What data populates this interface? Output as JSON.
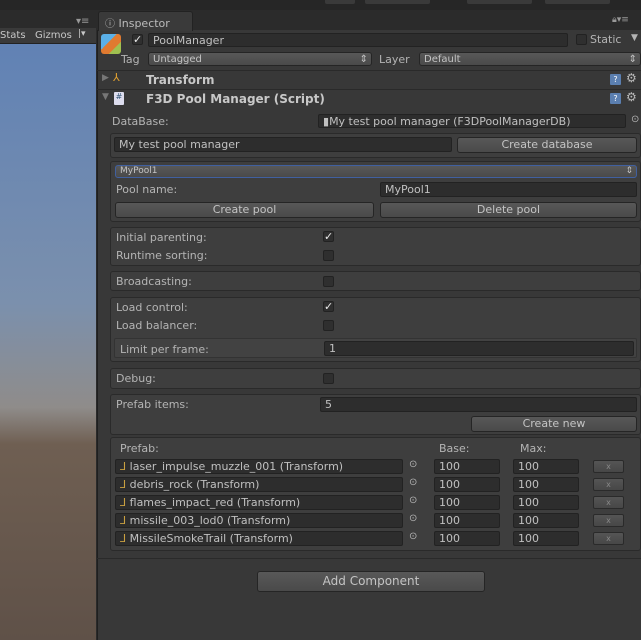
{
  "scene": {
    "stats": "Stats",
    "gizmos": "Gizmos"
  },
  "inspector": {
    "tab_label": "Inspector",
    "object_name": "PoolManager",
    "active": true,
    "static_label": "Static",
    "tag_label": "Tag",
    "tag_value": "Untagged",
    "layer_label": "Layer",
    "layer_value": "Default",
    "components": [
      {
        "name": "Transform",
        "expanded": false
      },
      {
        "name": "F3D Pool Manager (Script)",
        "expanded": true
      }
    ],
    "script": {
      "database_label": "DataBase:",
      "database_value": "My test pool manager (F3DPoolManagerDB)",
      "db_name_value": "My test pool manager",
      "create_database": "Create database",
      "pool_select": "MyPool1",
      "pool_name_label": "Pool name:",
      "pool_name_value": "MyPool1",
      "create_pool": "Create pool",
      "delete_pool": "Delete pool",
      "initial_parenting": {
        "label": "Initial parenting:",
        "checked": true
      },
      "runtime_sorting": {
        "label": "Runtime sorting:",
        "checked": false
      },
      "broadcasting": {
        "label": "Broadcasting:",
        "checked": false
      },
      "load_control": {
        "label": "Load control:",
        "checked": true
      },
      "load_balancer": {
        "label": "Load balancer:",
        "checked": false
      },
      "limit_label": "Limit per frame:",
      "limit_value": "1",
      "debug": {
        "label": "Debug:",
        "checked": false
      },
      "prefab_items_label": "Prefab items:",
      "prefab_items_value": "5",
      "create_new": "Create new",
      "col_prefab": "Prefab:",
      "col_base": "Base:",
      "col_max": "Max:",
      "prefabs": [
        {
          "name": "laser_impulse_muzzle_001 (Transform)",
          "base": "100",
          "max": "100",
          "remove": "x"
        },
        {
          "name": "debris_rock (Transform)",
          "base": "100",
          "max": "100",
          "remove": "x"
        },
        {
          "name": "flames_impact_red (Transform)",
          "base": "100",
          "max": "100",
          "remove": "x"
        },
        {
          "name": "missile_003_lod0 (Transform)",
          "base": "100",
          "max": "100",
          "remove": "x"
        },
        {
          "name": "MissileSmokeTrail (Transform)",
          "base": "100",
          "max": "100",
          "remove": "x"
        }
      ]
    },
    "add_component": "Add Component"
  }
}
